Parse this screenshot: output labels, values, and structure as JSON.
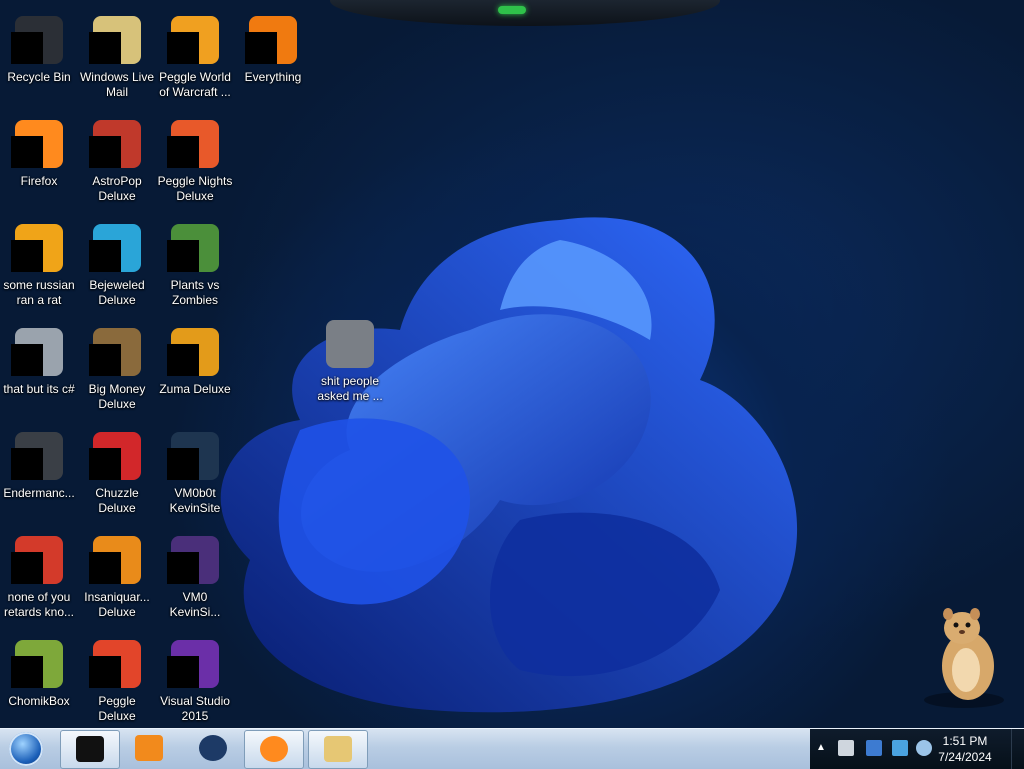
{
  "desktop": {
    "icons": [
      {
        "label": "Recycle Bin",
        "icon": "recycle-bin-icon",
        "color": "#2b2f36"
      },
      {
        "label": "Windows Live Mail",
        "icon": "mail-icon",
        "color": "#d7c27a"
      },
      {
        "label": "Peggle World of Warcraft ...",
        "icon": "peggle-wow-icon",
        "color": "#f0a020"
      },
      {
        "label": "Everything",
        "icon": "search-magnifier-icon",
        "color": "#f07a10"
      },
      {
        "label": "Firefox",
        "icon": "firefox-icon",
        "color": "#ff8a1e"
      },
      {
        "label": "AstroPop Deluxe",
        "icon": "astropop-icon",
        "color": "#c0392b"
      },
      {
        "label": "Peggle Nights Deluxe",
        "icon": "peggle-nights-icon",
        "color": "#e8592a"
      },
      {
        "label": "some russian ran a rat",
        "icon": "archive-icon",
        "color": "#f0a418"
      },
      {
        "label": "Bejeweled Deluxe",
        "icon": "bejeweled-icon",
        "color": "#2aa5d8"
      },
      {
        "label": "Plants vs Zombies",
        "icon": "plants-vs-zombies-icon",
        "color": "#4b8f3a"
      },
      {
        "label": "that but its c#",
        "icon": "stacked-windows-icon",
        "color": "#9aa3ad"
      },
      {
        "label": "Big Money Deluxe",
        "icon": "money-bag-icon",
        "color": "#8a6a3c"
      },
      {
        "label": "Zuma Deluxe",
        "icon": "zuma-icon",
        "color": "#e39b1a"
      },
      {
        "label": "Endermanc...",
        "icon": "console-window-icon",
        "color": "#3a3f46"
      },
      {
        "label": "Chuzzle Deluxe",
        "icon": "chuzzle-icon",
        "color": "#d2272a"
      },
      {
        "label": "VM0b0t KevinSite",
        "icon": "vm-display-icon",
        "color": "#1e3550"
      },
      {
        "label": "none of you retards kno...",
        "icon": "red-circle-icon",
        "color": "#d33a2a"
      },
      {
        "label": "Insaniquar... Deluxe",
        "icon": "fish-icon",
        "color": "#e98b1a"
      },
      {
        "label": "VM0 KevinSi...",
        "icon": "vm-purple-icon",
        "color": "#4a2f7a"
      },
      {
        "label": "ChomikBox",
        "icon": "chomikbox-icon",
        "color": "#7ea83a"
      },
      {
        "label": "Peggle Deluxe",
        "icon": "peggle-icon",
        "color": "#e2452a"
      },
      {
        "label": "Visual Studio 2015",
        "icon": "visual-studio-icon",
        "color": "#6b2fa8"
      },
      {
        "label": "shit people asked me ...",
        "icon": "folder-icon",
        "color": "#7a7f86"
      }
    ]
  },
  "taskbar": {
    "buttons": [
      {
        "name": "task-cmd",
        "icon": "terminal-icon",
        "color": "#111"
      },
      {
        "name": "task-media",
        "icon": "media-player-icon",
        "color": "#f28a1c"
      },
      {
        "name": "task-globe",
        "icon": "globe-icon",
        "color": "#1d3a66"
      },
      {
        "name": "task-firefox",
        "icon": "firefox-icon",
        "color": "#ff8a1e"
      },
      {
        "name": "task-explorer",
        "icon": "folder-icon",
        "color": "#e6c774"
      }
    ],
    "tray_icons": [
      "usb-icon",
      "network-icon",
      "display-icon",
      "volume-icon"
    ],
    "clock": {
      "time": "1:51 PM",
      "date": "7/24/2024"
    }
  },
  "colors": {
    "accent": "#1b5fb8",
    "wallpaper_blue": "#1d56e0"
  }
}
